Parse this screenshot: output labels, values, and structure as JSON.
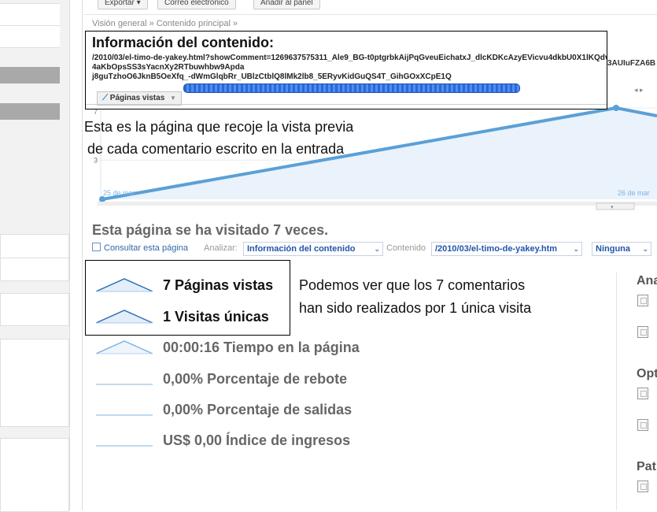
{
  "toolbar": {
    "export_label": "Exportar",
    "email_label": "Correo electrónico",
    "add_panel_label": "Añadir al panel"
  },
  "breadcrumb": "Visión general » Contenido principal »",
  "info": {
    "title": "Información del contenido:",
    "url": "/2010/03/el-timo-de-yakey.html?showComment=1269637575311_Ale9_BG-t0ptgrbkAijPqGveuEichatxJ_dlcKDKcAzyEVicvu4dkbU0X1lKQdvzalQRkWLHB63bAzZ4aKbOpsSS3sYacnXy2RTbuwhbw9Apda",
    "url_overflow": "3AUIuFZA6B",
    "url_line2": "j8guTzhoO6JknB5OeXfq_-dWmGlqbRr_UBlzCtblQ8lMk2lb8_5ERyvKidGuQS4T_GihGOxXCpE1Q",
    "tab_label": "Páginas vistas"
  },
  "chart_data": {
    "type": "line",
    "x": [
      "25 de mar",
      "26 de mar"
    ],
    "y": [
      0,
      7
    ],
    "y_ticks": [
      "7",
      "3"
    ],
    "ylim": [
      0,
      7
    ],
    "x_tick_labels": [
      "25 de mar",
      "26 de mar"
    ],
    "color": "#5aa0d6",
    "fill": "#eaf2fb"
  },
  "chart_callout": {
    "line1": "Esta es la página que recoje la vista previa",
    "line2": "de cada comentario escrito en la entrada"
  },
  "visits_text": "Esta página se ha visitado 7 veces.",
  "filters": {
    "consult_label": "Consultar esta página",
    "analyze_label": "Analizar:",
    "analyze_value": "Información del contenido",
    "content_label": "Contenido",
    "content_value": "/2010/03/el-timo-de-yakey.htm",
    "segment_value": "Ninguna"
  },
  "metrics": [
    {
      "text": "7 Páginas vistas"
    },
    {
      "text": "1 Visitas únicas"
    },
    {
      "text": "00:00:16 Tiempo en la página"
    },
    {
      "text": "0,00% Porcentaje de rebote"
    },
    {
      "text": "0,00% Porcentaje de salidas"
    },
    {
      "text": "US$ 0,00 Índice de ingresos"
    }
  ],
  "metric_callout": {
    "line1": "Podemos ver que los 7 comentarios",
    "line2": "han sido realizados por 1 única visita"
  },
  "right_panel": {
    "heading1": "Ana",
    "heading2": "Opt",
    "heading3": "Pat"
  },
  "colors": {
    "accent": "#5aa0d6",
    "link": "#3366aa",
    "progress": "#2a67d8"
  }
}
